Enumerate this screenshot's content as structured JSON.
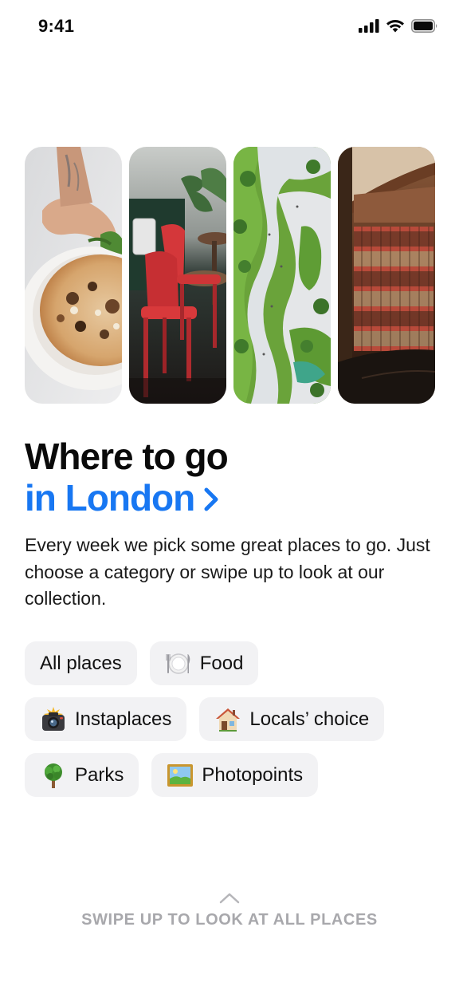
{
  "status_bar": {
    "time": "9:41",
    "icons": [
      "cellular-signal-icon",
      "wifi-icon",
      "battery-icon"
    ]
  },
  "gallery": {
    "photos": [
      {
        "subject": "pizza"
      },
      {
        "subject": "red-chairs"
      },
      {
        "subject": "park-aerial"
      },
      {
        "subject": "library"
      }
    ]
  },
  "headline": {
    "line1": "Where to go",
    "line2": "in London"
  },
  "description": "Every week we pick some great places to go. Just choose a category or swipe up to look at our collection.",
  "categories": [
    {
      "label": "All places",
      "icon": ""
    },
    {
      "label": "Food",
      "icon": "plate-icon"
    },
    {
      "label": "Instaplaces",
      "icon": "camera-flash-icon"
    },
    {
      "label": "Locals’ choice",
      "icon": "house-icon"
    },
    {
      "label": "Parks",
      "icon": "tree-icon"
    },
    {
      "label": "Photopoints",
      "icon": "framed-picture-icon"
    }
  ],
  "swipe_hint": {
    "text": "SWIPE UP TO LOOK AT ALL PLACES"
  },
  "colors": {
    "accent": "#1877f2",
    "chip_bg": "#f2f2f4",
    "hint": "#a8a8ac"
  }
}
